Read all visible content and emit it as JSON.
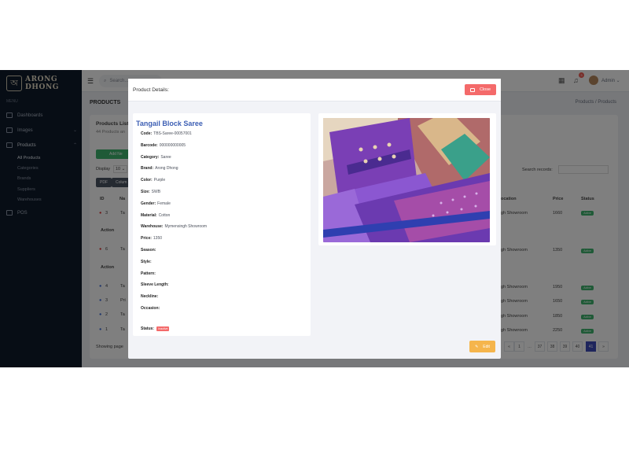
{
  "app": {
    "brand": "ARONG DHONG",
    "logo_glyph": "অ"
  },
  "sidebar": {
    "heading": "MENU",
    "items": [
      {
        "label": "Dashboards",
        "icon": "home-icon"
      },
      {
        "label": "Images",
        "icon": "image-icon"
      },
      {
        "label": "Products",
        "icon": "box-icon"
      }
    ],
    "subitems": [
      "All Products",
      "Categories",
      "Brands",
      "Suppliers",
      "Warehouses"
    ],
    "pos_label": "POS"
  },
  "topbar": {
    "search_placeholder": "Search...",
    "user": "Admin",
    "notif_count": "3"
  },
  "page": {
    "title": "PRODUCTS",
    "breadcrumb": "Products  /  Products",
    "list_title": "Products List",
    "list_sub": "44 Products an",
    "add_btn": "Add Ne",
    "display_label": "Display",
    "display_value": "10",
    "pdf_btn": "PDF",
    "col_btn": "Colum",
    "search_label": "Search records:",
    "col_id": "ID",
    "col_name": "Na",
    "col_location": "ocation",
    "col_price": "Price",
    "col_status": "Status",
    "action_label": "Action",
    "showing": "Showing page",
    "rows": [
      {
        "id": "3",
        "name": "Ta",
        "location": "gh Showroom",
        "price": "1660",
        "status": "Active"
      },
      {
        "id": "6",
        "name": "Ta",
        "location": "gh Showroom",
        "price": "1350",
        "status": "Active"
      },
      {
        "id": "4",
        "name": "Ta",
        "location": "gh Showroom",
        "price": "1950",
        "status": "Active"
      },
      {
        "id": "3",
        "name": "Pri",
        "location": "gh Showroom",
        "price": "1650",
        "status": "Active"
      },
      {
        "id": "2",
        "name": "Ta",
        "location": "gh Showroom",
        "price": "1850",
        "status": "Active"
      },
      {
        "id": "1",
        "name": "Ta",
        "location": "gh Showroom",
        "price": "2250",
        "status": "Active"
      }
    ],
    "pagination": [
      "«",
      "1",
      "…",
      "37",
      "38",
      "39",
      "40",
      "41",
      "»"
    ],
    "active_page": "41"
  },
  "modal": {
    "title": "Product Details:",
    "close_label": "Close",
    "edit_label": "Edit",
    "product_name": "Tangail Block Saree",
    "fields": [
      {
        "label": "Code:",
        "value": "TBS-Saree-00057001"
      },
      {
        "label": "Barcode:",
        "value": "000000000005"
      },
      {
        "label": "Category:",
        "value": "Saree"
      },
      {
        "label": "Brand:",
        "value": "Arong Dhong"
      },
      {
        "label": "Color:",
        "value": "Purple"
      },
      {
        "label": "Size:",
        "value": "SWB"
      },
      {
        "label": "Gender:",
        "value": "Female"
      },
      {
        "label": "Material:",
        "value": "Cotton"
      },
      {
        "label": "Warehouse:",
        "value": "Mymensingh Showroom"
      },
      {
        "label": "Price:",
        "value": "1350"
      },
      {
        "label": "Season:",
        "value": ""
      },
      {
        "label": "Style:",
        "value": ""
      },
      {
        "label": "Pattern:",
        "value": ""
      },
      {
        "label": "Sleeve Length:",
        "value": ""
      },
      {
        "label": "Neckline:",
        "value": ""
      },
      {
        "label": "Occasion:",
        "value": ""
      }
    ],
    "status_label": "Status:",
    "status_value": "Inactive"
  },
  "colors": {
    "sidebar": "#0f1b2b",
    "accent": "#3d5fb4",
    "danger": "#f46a6a",
    "warning": "#f5b54c",
    "success": "#3fb56f"
  }
}
